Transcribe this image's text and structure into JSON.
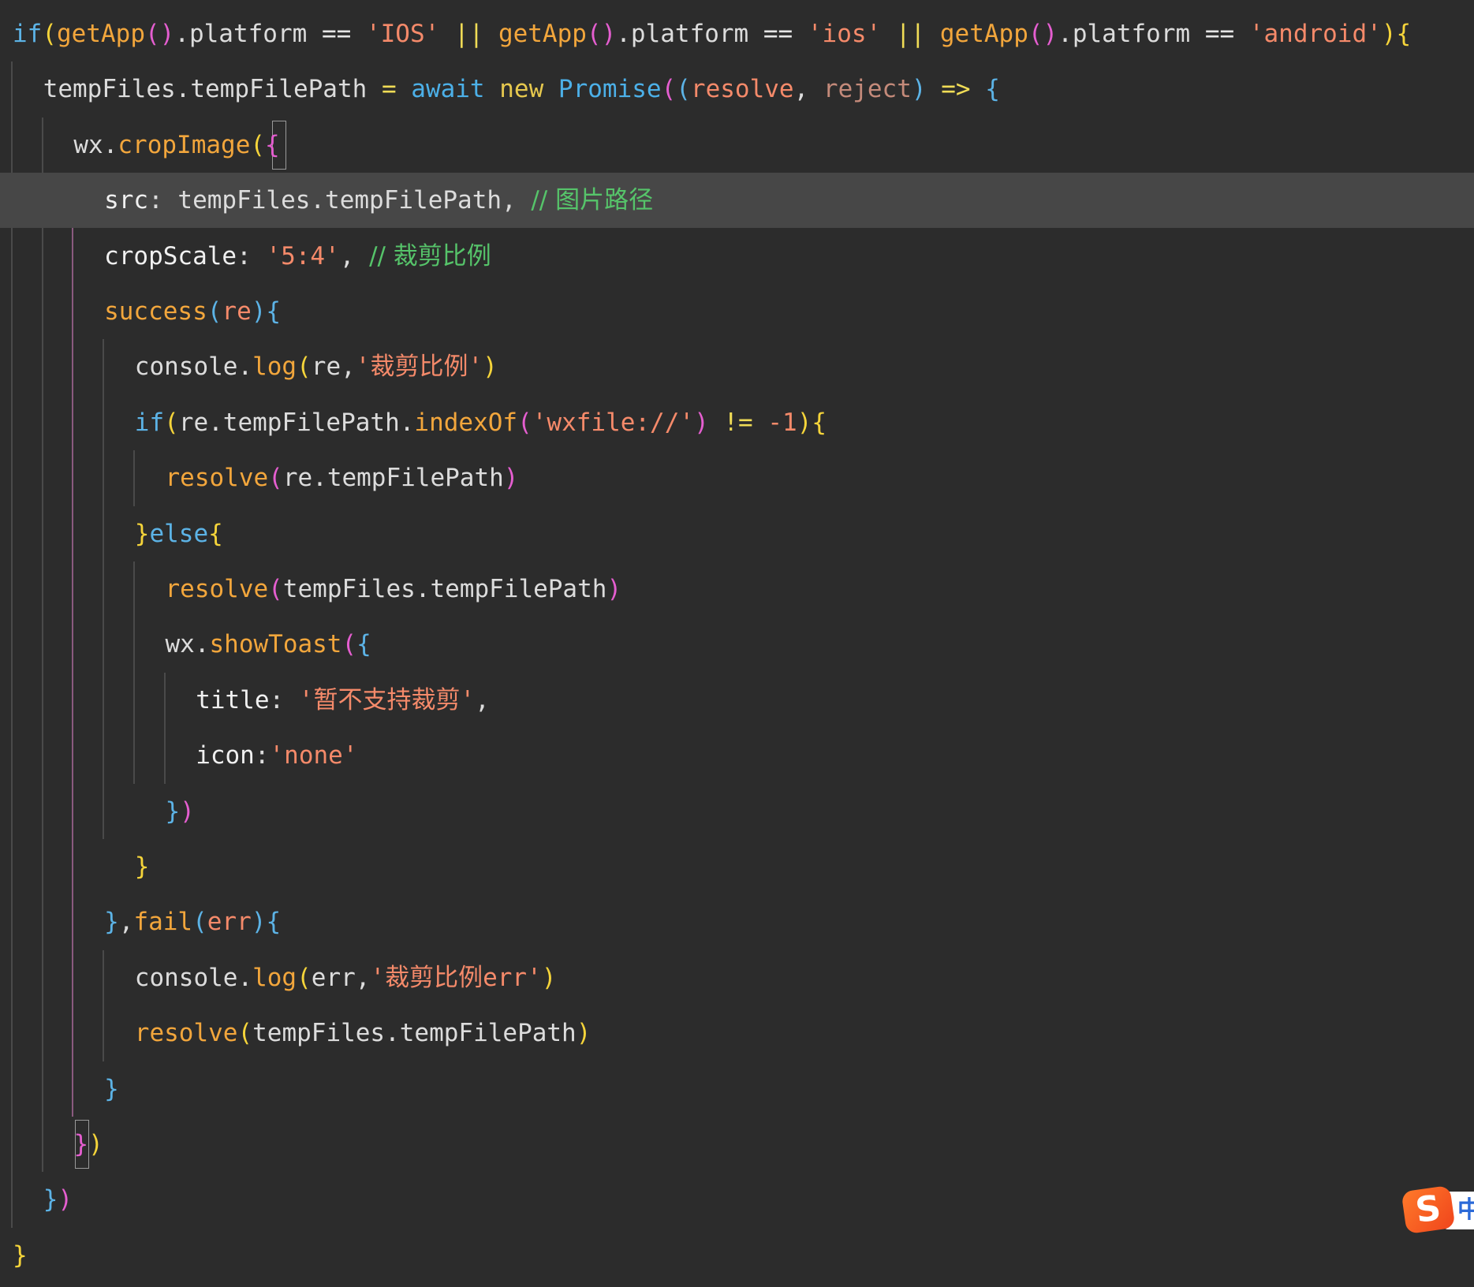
{
  "editor": {
    "lines": [
      {
        "tokens": [
          {
            "t": "if",
            "c": "kw"
          },
          {
            "t": "(",
            "c": "p1"
          },
          {
            "t": "getApp",
            "c": "fn"
          },
          {
            "t": "()",
            "c": "p2"
          },
          {
            "t": ".platform ",
            "c": "ident"
          },
          {
            "t": "== ",
            "c": "op"
          },
          {
            "t": "'IOS'",
            "c": "str"
          },
          {
            "t": " || ",
            "c": "opy"
          },
          {
            "t": "getApp",
            "c": "fn"
          },
          {
            "t": "()",
            "c": "p2"
          },
          {
            "t": ".platform ",
            "c": "ident"
          },
          {
            "t": "== ",
            "c": "op"
          },
          {
            "t": "'ios'",
            "c": "str"
          },
          {
            "t": " || ",
            "c": "opy"
          },
          {
            "t": "getApp",
            "c": "fn"
          },
          {
            "t": "()",
            "c": "p2"
          },
          {
            "t": ".platform ",
            "c": "ident"
          },
          {
            "t": "== ",
            "c": "op"
          },
          {
            "t": "'android'",
            "c": "str"
          },
          {
            "t": ")",
            "c": "p1"
          },
          {
            "t": "{",
            "c": "p1"
          }
        ]
      },
      {
        "tokens": [
          {
            "t": "tempFiles.tempFilePath ",
            "c": "ident"
          },
          {
            "t": "= ",
            "c": "opy"
          },
          {
            "t": "await ",
            "c": "fnb"
          },
          {
            "t": "new ",
            "c": "kw2"
          },
          {
            "t": "Promise",
            "c": "fnb"
          },
          {
            "t": "(",
            "c": "p2"
          },
          {
            "t": "(",
            "c": "p3"
          },
          {
            "t": "resolve",
            "c": "param"
          },
          {
            "t": ", ",
            "c": "ident"
          },
          {
            "t": "reject",
            "c": "param2"
          },
          {
            "t": ") ",
            "c": "p3"
          },
          {
            "t": "=> ",
            "c": "opy"
          },
          {
            "t": "{",
            "c": "p3"
          }
        ]
      },
      {
        "tokens": [
          {
            "t": "wx.",
            "c": "ident"
          },
          {
            "t": "cropImage",
            "c": "fn"
          },
          {
            "t": "(",
            "c": "p1"
          },
          {
            "t": "{",
            "c": "p2"
          }
        ]
      },
      {
        "tokens": [
          {
            "t": "src",
            "c": "prop"
          },
          {
            "t": ": ",
            "c": "ident"
          },
          {
            "t": "tempFiles.tempFilePath",
            "c": "ident"
          },
          {
            "t": ", ",
            "c": "ident"
          },
          {
            "t": "// 图片路径",
            "c": "cmt"
          }
        ]
      },
      {
        "tokens": [
          {
            "t": "cropScale",
            "c": "prop"
          },
          {
            "t": ": ",
            "c": "ident"
          },
          {
            "t": "'5:4'",
            "c": "str"
          },
          {
            "t": ", ",
            "c": "ident"
          },
          {
            "t": "// 裁剪比例",
            "c": "cmt"
          }
        ]
      },
      {
        "tokens": [
          {
            "t": "success",
            "c": "fn"
          },
          {
            "t": "(",
            "c": "p3"
          },
          {
            "t": "re",
            "c": "param"
          },
          {
            "t": ")",
            "c": "p3"
          },
          {
            "t": "{",
            "c": "p3"
          }
        ]
      },
      {
        "tokens": [
          {
            "t": "console.",
            "c": "ident"
          },
          {
            "t": "log",
            "c": "fn"
          },
          {
            "t": "(",
            "c": "p1"
          },
          {
            "t": "re,",
            "c": "ident"
          },
          {
            "t": "'裁剪比例'",
            "c": "str"
          },
          {
            "t": ")",
            "c": "p1"
          }
        ]
      },
      {
        "tokens": [
          {
            "t": "if",
            "c": "kw"
          },
          {
            "t": "(",
            "c": "p1"
          },
          {
            "t": "re.tempFilePath.",
            "c": "ident"
          },
          {
            "t": "indexOf",
            "c": "fn"
          },
          {
            "t": "(",
            "c": "p2"
          },
          {
            "t": "'wxfile://'",
            "c": "str"
          },
          {
            "t": ") ",
            "c": "p2"
          },
          {
            "t": "!= ",
            "c": "opy"
          },
          {
            "t": "-1",
            "c": "num"
          },
          {
            "t": ")",
            "c": "p1"
          },
          {
            "t": "{",
            "c": "p1"
          }
        ]
      },
      {
        "tokens": [
          {
            "t": "resolve",
            "c": "fn"
          },
          {
            "t": "(",
            "c": "p2"
          },
          {
            "t": "re.tempFilePath",
            "c": "ident"
          },
          {
            "t": ")",
            "c": "p2"
          }
        ]
      },
      {
        "tokens": [
          {
            "t": "}",
            "c": "p1"
          },
          {
            "t": "else",
            "c": "kw"
          },
          {
            "t": "{",
            "c": "p1"
          }
        ]
      },
      {
        "tokens": [
          {
            "t": "resolve",
            "c": "fn"
          },
          {
            "t": "(",
            "c": "p2"
          },
          {
            "t": "tempFiles.tempFilePath",
            "c": "ident"
          },
          {
            "t": ")",
            "c": "p2"
          }
        ]
      },
      {
        "tokens": [
          {
            "t": "wx.",
            "c": "ident"
          },
          {
            "t": "showToast",
            "c": "fn"
          },
          {
            "t": "(",
            "c": "p2"
          },
          {
            "t": "{",
            "c": "p3"
          }
        ]
      },
      {
        "tokens": [
          {
            "t": "title",
            "c": "prop"
          },
          {
            "t": ": ",
            "c": "ident"
          },
          {
            "t": "'暂不支持裁剪'",
            "c": "str"
          },
          {
            "t": ",",
            "c": "ident"
          }
        ]
      },
      {
        "tokens": [
          {
            "t": "icon",
            "c": "prop"
          },
          {
            "t": ":",
            "c": "ident"
          },
          {
            "t": "'none'",
            "c": "str"
          }
        ]
      },
      {
        "tokens": [
          {
            "t": "}",
            "c": "p3"
          },
          {
            "t": ")",
            "c": "p2"
          }
        ]
      },
      {
        "tokens": [
          {
            "t": "}",
            "c": "p1"
          }
        ]
      },
      {
        "tokens": [
          {
            "t": "}",
            "c": "p3"
          },
          {
            "t": ",",
            "c": "ident"
          },
          {
            "t": "fail",
            "c": "fn"
          },
          {
            "t": "(",
            "c": "p3"
          },
          {
            "t": "err",
            "c": "param"
          },
          {
            "t": ")",
            "c": "p3"
          },
          {
            "t": "{",
            "c": "p3"
          }
        ]
      },
      {
        "tokens": [
          {
            "t": "console.",
            "c": "ident"
          },
          {
            "t": "log",
            "c": "fn"
          },
          {
            "t": "(",
            "c": "p1"
          },
          {
            "t": "err,",
            "c": "ident"
          },
          {
            "t": "'裁剪比例err'",
            "c": "str"
          },
          {
            "t": ")",
            "c": "p1"
          }
        ]
      },
      {
        "tokens": [
          {
            "t": "resolve",
            "c": "fn"
          },
          {
            "t": "(",
            "c": "p1"
          },
          {
            "t": "tempFiles.tempFilePath",
            "c": "ident"
          },
          {
            "t": ")",
            "c": "p1"
          }
        ]
      },
      {
        "tokens": [
          {
            "t": "}",
            "c": "p3"
          }
        ]
      },
      {
        "tokens": [
          {
            "t": "}",
            "c": "p2"
          },
          {
            "t": ")",
            "c": "p1"
          }
        ]
      },
      {
        "tokens": [
          {
            "t": "}",
            "c": "p3"
          },
          {
            "t": ")",
            "c": "p2"
          }
        ]
      },
      {
        "tokens": [
          {
            "t": "}",
            "c": "p1"
          }
        ]
      }
    ],
    "current_line": 3,
    "colors": {
      "background": "#2c2c2c",
      "current_line": "#474747",
      "string": "#f58a6a",
      "function": "#f2a63c",
      "keyword": "#5cb3e6",
      "comment": "#56c46a"
    }
  },
  "ime": {
    "logo": "S",
    "mode": "中",
    "icon": "sogou-ime-icon"
  }
}
